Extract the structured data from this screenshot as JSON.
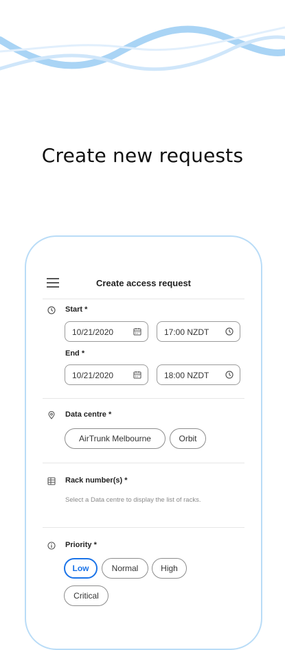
{
  "headline": "Create new requests",
  "colors": {
    "accent": "#1a73e8",
    "wave": "#a9d4f5",
    "phone_border": "#b9dcf7"
  },
  "appbar": {
    "title": "Create access request",
    "menu_icon": "hamburger-menu-icon"
  },
  "start": {
    "label": "Start *",
    "date": "10/21/2020",
    "time": "17:00 NZDT"
  },
  "end": {
    "label": "End *",
    "date": "10/21/2020",
    "time": "18:00 NZDT"
  },
  "data_centre": {
    "label": "Data centre *",
    "options": [
      "AirTrunk Melbourne",
      "Orbit"
    ]
  },
  "rack": {
    "label": "Rack number(s) *",
    "hint": "Select a Data centre to display the list of racks."
  },
  "priority": {
    "label": "Priority *",
    "options": [
      "Low",
      "Normal",
      "High",
      "Critical"
    ],
    "selected": "Low"
  }
}
